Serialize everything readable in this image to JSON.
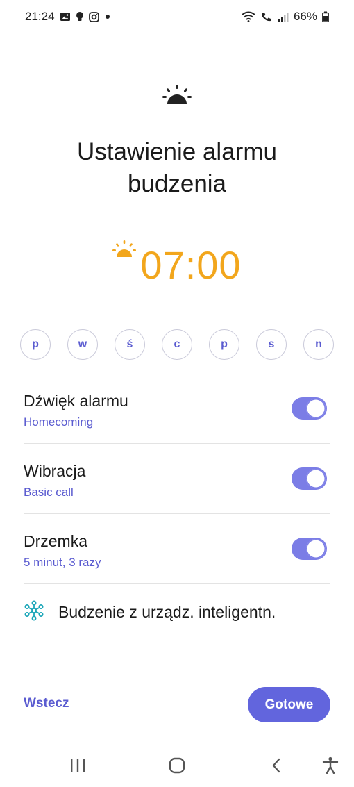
{
  "status_bar": {
    "time": "21:24",
    "battery": "66%",
    "left_icons": [
      "gallery-icon",
      "bulb-icon",
      "instagram-icon",
      "dot-icon"
    ],
    "right_icons": [
      "wifi-icon",
      "call-icon",
      "signal-icon",
      "battery-icon"
    ]
  },
  "header": {
    "icon": "sunrise-icon",
    "title": "Ustawienie alarmu budzenia"
  },
  "alarm": {
    "time": "07:00",
    "accent": "#f2a61c"
  },
  "days": [
    {
      "label": "p"
    },
    {
      "label": "w"
    },
    {
      "label": "ś"
    },
    {
      "label": "c"
    },
    {
      "label": "p"
    },
    {
      "label": "s"
    },
    {
      "label": "n"
    }
  ],
  "settings": [
    {
      "title": "Dźwięk alarmu",
      "subtitle": "Homecoming",
      "enabled": true
    },
    {
      "title": "Wibracja",
      "subtitle": "Basic call",
      "enabled": true
    },
    {
      "title": "Drzemka",
      "subtitle": "5 minut, 3 razy",
      "enabled": true
    }
  ],
  "smart_wake": {
    "icon": "smartthings-icon",
    "label": "Budzenie z urządz. inteligentn."
  },
  "footer": {
    "back_label": "Wstecz",
    "done_label": "Gotowe"
  },
  "colors": {
    "primary": "#5a5bd0",
    "toggle_on": "#7b7de6",
    "button": "#6265dd"
  },
  "nav": [
    "recent-apps-icon",
    "home-icon",
    "back-icon",
    "accessibility-icon"
  ]
}
